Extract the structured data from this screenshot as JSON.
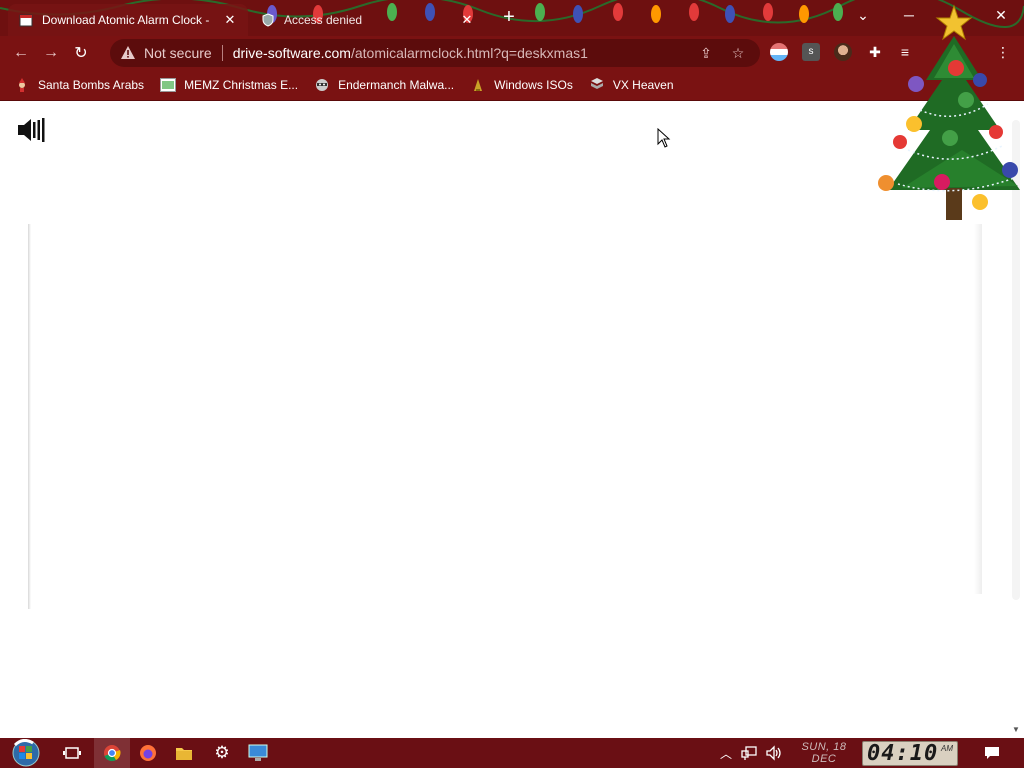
{
  "browser": {
    "tabs": [
      {
        "title": "Download Atomic Alarm Clock -",
        "active": true
      },
      {
        "title": "Access denied",
        "active": false
      }
    ],
    "new_tab_label": "+",
    "window_controls": {
      "dropdown": "⌄",
      "minimize": "─",
      "close": "✕"
    }
  },
  "address_bar": {
    "security_label": "Not secure",
    "domain": "drive-software.com",
    "path": "/atomicalarmclock.html?q=deskxmas1"
  },
  "bookmarks": [
    {
      "label": "Santa Bombs Arabs",
      "icon": "santa-icon"
    },
    {
      "label": "MEMZ Christmas E...",
      "icon": "image-icon"
    },
    {
      "label": "Endermanch Malwa...",
      "icon": "raccoon-icon"
    },
    {
      "label": "Windows ISOs",
      "icon": "folder-icon"
    },
    {
      "label": "VX Heaven",
      "icon": "shield-icon"
    }
  ],
  "taskbar": {
    "date_line1": "SUN, 18",
    "date_line2": "DEC",
    "clock": "04:10",
    "clock_ampm": "AM"
  },
  "colors": {
    "frame": "#7a1212",
    "tabstrip": "#6e1010",
    "taskbar": "#6a0f14"
  }
}
